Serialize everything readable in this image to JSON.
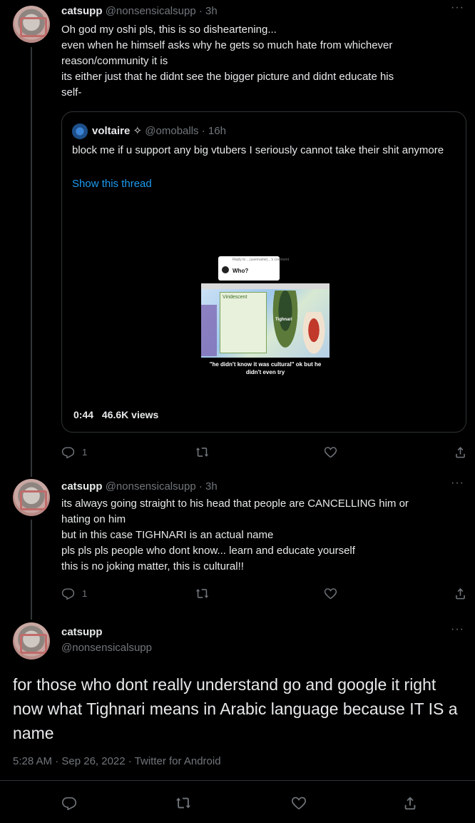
{
  "tweet1": {
    "name": "catsupp",
    "handle": "@nonsensicalsupp",
    "time": "3h",
    "lines": [
      "Oh god my oshi pls, this is so disheartening...",
      "even when he himself asks why he gets so much hate from whichever",
      "reason/community it is",
      "its either just that he didnt see the bigger picture and didnt educate his",
      "self-"
    ],
    "quote": {
      "name": "voltaire",
      "name_symbol": "✧",
      "handle": "@omoballs",
      "time": "16h",
      "text": "block me if u support any big vtubers I seriously cannot take their shit anymore",
      "show_thread": "Show this thread",
      "video": {
        "bubble_small": "Reply to ...(username)...'s comment",
        "bubble_who": "Who?",
        "label_left": "Viridescent",
        "label_right": "Tighnari",
        "caption": "\"he didn't know it was cultural\" ok but he didn't even try"
      },
      "duration": "0:44",
      "views": "46.6K views"
    },
    "reply_count": "1"
  },
  "tweet2": {
    "name": "catsupp",
    "handle": "@nonsensicalsupp",
    "time": "3h",
    "lines": [
      "its always going straight to his head that people are CANCELLING him or",
      "hating on him",
      "but in this case TIGHNARI is an actual name",
      "pls pls pls people who dont know... learn and educate yourself",
      "this is no joking matter, this is cultural!!"
    ],
    "reply_count": "1"
  },
  "tweet3": {
    "name": "catsupp",
    "handle": "@nonsensicalsupp",
    "text": "for those who dont really understand go and google it right now what Tighnari means in Arabic language because IT IS a name",
    "timestamp": "5:28 AM · Sep 26, 2022 · Twitter for Android"
  },
  "icons": {
    "more": "more-horizontal-icon",
    "reply": "reply-icon",
    "retweet": "retweet-icon",
    "like": "like-icon",
    "share": "share-icon"
  },
  "colors": {
    "background": "#000000",
    "text": "#e7e9ea",
    "muted": "#71767b",
    "link": "#1d9bf0",
    "border": "#2f3336"
  }
}
